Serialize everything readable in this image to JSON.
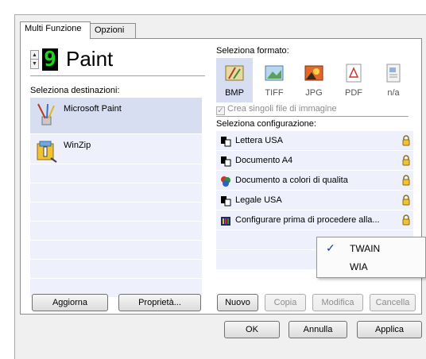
{
  "tabs": [
    {
      "label": "Multi Funzione"
    },
    {
      "label": "Opzioni"
    }
  ],
  "app": {
    "digit": "9",
    "name": "Paint"
  },
  "destinations": {
    "label": "Seleziona destinazioni:",
    "items": [
      {
        "label": "Microsoft Paint",
        "icon": "paint-brush-icon"
      },
      {
        "label": "WinZip",
        "icon": "winzip-icon"
      }
    ]
  },
  "left_buttons": {
    "update": "Aggiorna",
    "properties": "Proprietà..."
  },
  "formats": {
    "label": "Seleziona formato:",
    "items": [
      {
        "label": "BMP",
        "icon": "bmp-icon"
      },
      {
        "label": "TIFF",
        "icon": "tiff-icon"
      },
      {
        "label": "JPG",
        "icon": "jpg-icon"
      },
      {
        "label": "PDF",
        "icon": "pdf-icon"
      },
      {
        "label": "n/a",
        "icon": "na-icon"
      }
    ],
    "selected": "BMP"
  },
  "single_files": {
    "label": "Crea singoli file di immagine",
    "checked": true,
    "enabled": false
  },
  "configurations": {
    "label": "Seleziona configurazione:",
    "items": [
      {
        "label": "Lettera USA"
      },
      {
        "label": "Documento A4"
      },
      {
        "label": "Documento a colori di qualita"
      },
      {
        "label": "Legale USA"
      },
      {
        "label": "Configurare prima di procedere alla..."
      }
    ]
  },
  "right_buttons": {
    "new": "Nuovo",
    "copy": "Copia",
    "edit": "Modifica",
    "delete": "Cancella"
  },
  "dialog_buttons": {
    "ok": "OK",
    "cancel": "Annulla",
    "apply": "Applica"
  },
  "popup_menu": {
    "items": [
      {
        "label": "TWAIN",
        "checked": true
      },
      {
        "label": "WIA",
        "checked": false
      }
    ]
  },
  "colors": {
    "selection": "#d7def2",
    "list_bg": "#eef1fb",
    "digit": "#1ad51a"
  }
}
